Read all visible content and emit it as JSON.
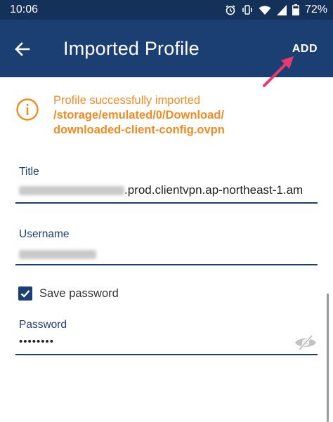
{
  "status_bar": {
    "time": "10:06",
    "battery": "72%",
    "icons": [
      "alarm-icon",
      "vibrate-icon",
      "wifi-icon",
      "signal-icon",
      "battery-icon"
    ]
  },
  "app_bar": {
    "title": "Imported Profile",
    "add_label": "ADD",
    "back_icon": "back-arrow-icon"
  },
  "notice": {
    "message": "Profile successfully imported",
    "path_line1": "/storage/emulated/0/Download/",
    "path_line2": "downloaded-client-config.ovpn",
    "icon": "info-icon"
  },
  "form": {
    "title_label": "Title",
    "title_value_suffix": ".prod.clientvpn.ap-northeast-1.am",
    "username_label": "Username",
    "save_password_label": "Save password",
    "save_password_checked": true,
    "password_label": "Password",
    "password_value": "••••••••"
  },
  "colors": {
    "app_bar": "#1c3f73",
    "status_bar": "#14315a",
    "accent_orange": "#f28b22",
    "annotation_pink": "#e83a6e"
  }
}
